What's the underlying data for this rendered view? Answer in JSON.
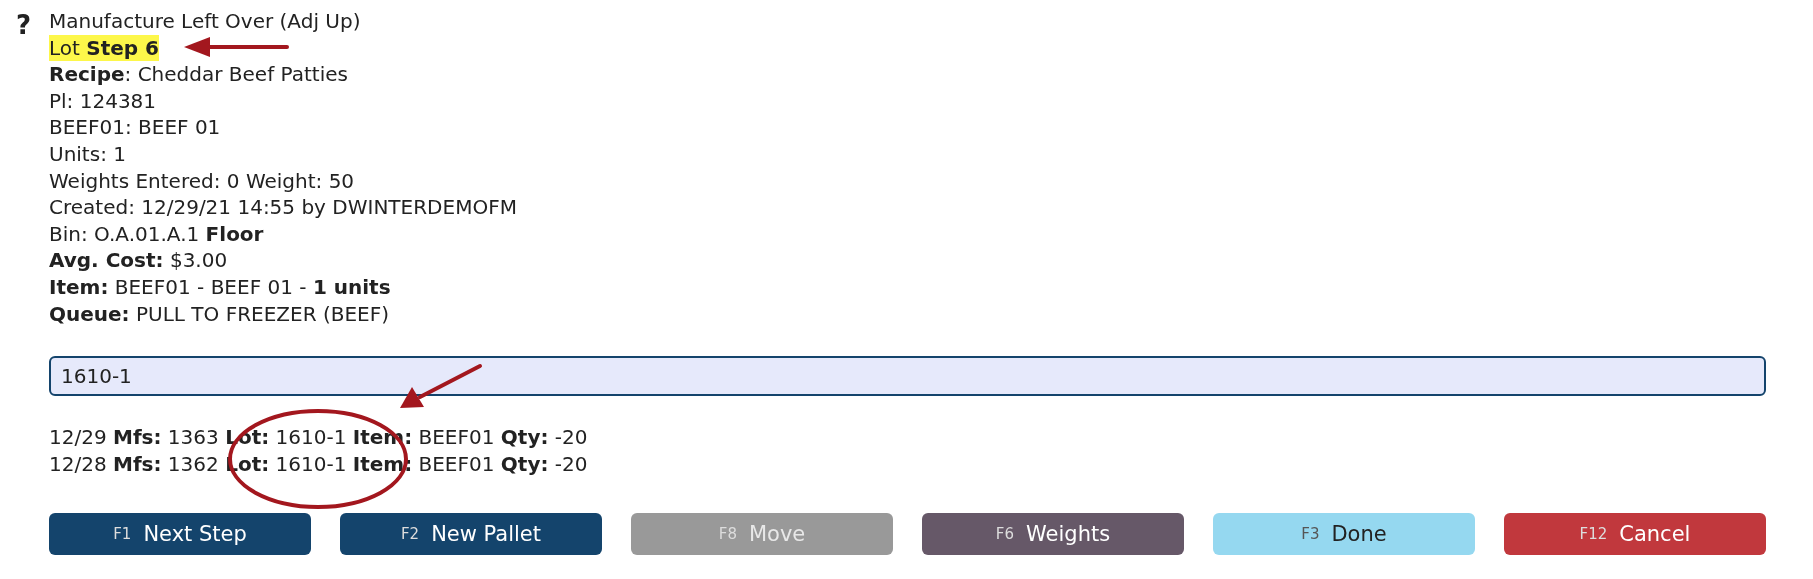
{
  "help": "?",
  "details": [
    {
      "text": "Manufacture Left Over (Adj Up)",
      "highlighted": false
    },
    {
      "text": "Lot **Step 6**",
      "highlighted": true
    },
    {
      "text": "**Recipe**: Cheddar Beef Patties",
      "highlighted": false
    },
    {
      "text": "Pl: 124381",
      "highlighted": false
    },
    {
      "text": "BEEF01: BEEF 01",
      "highlighted": false
    },
    {
      "text": "Units: 1",
      "highlighted": false
    },
    {
      "text": "Weights Entered: 0 Weight: 50",
      "highlighted": false
    },
    {
      "text": "Created: 12/29/21 14:55 by DWINTERDEMOFM",
      "highlighted": false
    },
    {
      "text": "Bin: O.A.01.A.1 **Floor**",
      "highlighted": false
    },
    {
      "text": "**Avg. Cost:** $3.00",
      "highlighted": false
    },
    {
      "text": "**Item:** BEEF01 - BEEF 01 - **1 units**",
      "highlighted": false
    },
    {
      "text": "**Queue:** PULL TO FREEZER (BEEF)",
      "highlighted": false
    }
  ],
  "lot_field": {
    "value": "1610-1"
  },
  "history": [
    "12/29 **Mfs:** 1363 **Lot:** 1610-1 **Item:** BEEF01 **Qty:** -20",
    "12/28 **Mfs:** 1362 **Lot:** 1610-1 **Item:** BEEF01 **Qty:** -20"
  ],
  "buttons": [
    {
      "key": "F1",
      "label": "Next Step",
      "color": "#14446c",
      "disabled": false
    },
    {
      "key": "F2",
      "label": "New Pallet",
      "color": "#14446c",
      "disabled": false
    },
    {
      "key": "F8",
      "label": "Move",
      "color": "#999999",
      "disabled": true
    },
    {
      "key": "F6",
      "label": "Weights",
      "color": "#665868",
      "disabled": false
    },
    {
      "key": "F3",
      "label": "Done",
      "color": "#95d8f0",
      "disabled": false
    },
    {
      "key": "F12",
      "label": "Cancel",
      "color": "#c1383d",
      "disabled": false
    }
  ]
}
